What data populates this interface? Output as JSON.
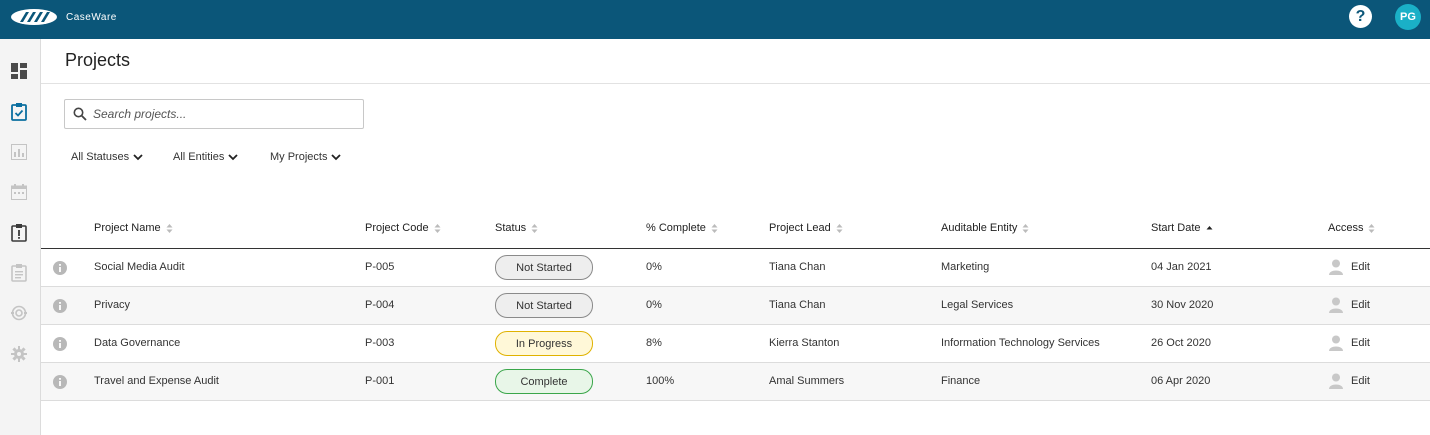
{
  "brand": {
    "name": "CaseWare"
  },
  "header": {
    "help_label": "?",
    "avatar_initials": "PG"
  },
  "sidebar": {
    "items": [
      {
        "icon": "dashboard-icon",
        "active": false
      },
      {
        "icon": "projects-checklist-icon",
        "active": true
      },
      {
        "icon": "reports-chart-icon",
        "active": false
      },
      {
        "icon": "calendar-icon",
        "active": false
      },
      {
        "icon": "issues-alert-icon",
        "active": false
      },
      {
        "icon": "clipboard-icon",
        "active": false
      },
      {
        "icon": "risk-icon",
        "active": false
      },
      {
        "icon": "settings-gear-icon",
        "active": false
      }
    ]
  },
  "page": {
    "title": "Projects"
  },
  "search": {
    "placeholder": "Search projects...",
    "value": ""
  },
  "filters": [
    {
      "label": "All Statuses"
    },
    {
      "label": "All Entities"
    },
    {
      "label": "My Projects"
    }
  ],
  "table": {
    "columns": [
      "Project Name",
      "Project Code",
      "Status",
      "% Complete",
      "Project Lead",
      "Auditable Entity",
      "Start Date",
      "Access"
    ],
    "sorted_column": "Start Date",
    "sort_direction": "ascending",
    "rows": [
      {
        "name": "Social Media Audit",
        "code": "P-005",
        "status": "Not Started",
        "status_key": "not-started",
        "complete": "0%",
        "lead": "Tiana Chan",
        "entity": "Marketing",
        "start": "04 Jan 2021",
        "access": "Edit"
      },
      {
        "name": "Privacy",
        "code": "P-004",
        "status": "Not Started",
        "status_key": "not-started",
        "complete": "0%",
        "lead": "Tiana Chan",
        "entity": "Legal Services",
        "start": "30 Nov 2020",
        "access": "Edit"
      },
      {
        "name": "Data Governance",
        "code": "P-003",
        "status": "In Progress",
        "status_key": "in-progress",
        "complete": "8%",
        "lead": "Kierra Stanton",
        "entity": "Information Technology Services",
        "start": "26 Oct 2020",
        "access": "Edit"
      },
      {
        "name": "Travel and Expense Audit",
        "code": "P-001",
        "status": "Complete",
        "status_key": "complete",
        "complete": "100%",
        "lead": "Amal Summers",
        "entity": "Finance",
        "start": "06 Apr 2020",
        "access": "Edit"
      }
    ]
  },
  "colors": {
    "topbar": "#0b5679",
    "avatar": "#1ab0c7",
    "active_icon": "#0b6fa0",
    "inactive_icon": "#c4c4c4"
  }
}
